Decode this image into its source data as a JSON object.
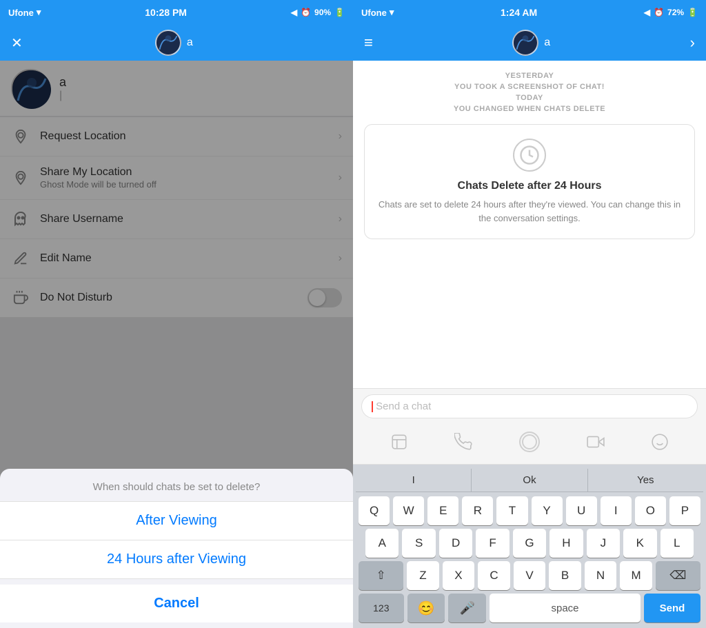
{
  "left": {
    "statusBar": {
      "carrier": "Ufone",
      "time": "10:28 PM",
      "battery": "90%"
    },
    "nav": {
      "username": "a"
    },
    "profile": {
      "name": "a",
      "inputPlaceholder": "|"
    },
    "menuItems": [
      {
        "id": "request-location",
        "icon": "📍",
        "title": "Request Location",
        "subtitle": "",
        "type": "chevron"
      },
      {
        "id": "share-location",
        "icon": "📍",
        "title": "Share My Location",
        "subtitle": "Ghost Mode will be turned off",
        "type": "chevron"
      },
      {
        "id": "share-username",
        "icon": "👻",
        "title": "Share Username",
        "subtitle": "",
        "type": "chevron"
      },
      {
        "id": "edit-name",
        "icon": "✏️",
        "title": "Edit Name",
        "subtitle": "",
        "type": "chevron"
      },
      {
        "id": "do-not-disturb",
        "icon": "💤",
        "title": "Do Not Disturb",
        "subtitle": "",
        "type": "toggle"
      }
    ],
    "modal": {
      "question": "When should chats be set to delete?",
      "options": [
        "After Viewing",
        "24 Hours after Viewing"
      ],
      "cancel": "Cancel"
    }
  },
  "right": {
    "statusBar": {
      "carrier": "Ufone",
      "time": "1:24 AM",
      "battery": "72%"
    },
    "nav": {
      "username": "a"
    },
    "chat": {
      "timestamps": [
        "YESTERDAY",
        "YOU TOOK A SCREENSHOT OF CHAT!",
        "TODAY",
        "YOU CHANGED WHEN CHATS DELETE"
      ],
      "card": {
        "title": "Chats Delete after 24 Hours",
        "description": "Chats are set to delete 24 hours after they're viewed. You can change this in the conversation settings."
      },
      "inputPlaceholder": "Send a chat"
    },
    "keyboard": {
      "suggestions": [
        "I",
        "Ok",
        "Yes"
      ],
      "rows": [
        [
          "Q",
          "W",
          "E",
          "R",
          "T",
          "Y",
          "U",
          "I",
          "O",
          "P"
        ],
        [
          "A",
          "S",
          "D",
          "F",
          "G",
          "H",
          "J",
          "K",
          "L"
        ],
        [
          "⇧",
          "Z",
          "X",
          "C",
          "V",
          "B",
          "N",
          "M",
          "⌫"
        ],
        [
          "123",
          "😊",
          "🎤",
          "space",
          "Send"
        ]
      ]
    }
  }
}
